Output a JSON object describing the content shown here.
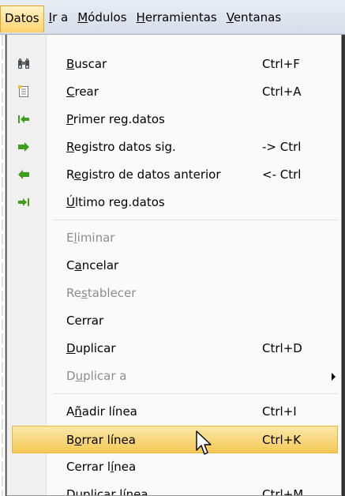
{
  "menubar": {
    "items": [
      {
        "label": "Datos",
        "mnemonic_index": -1
      },
      {
        "label": "Ir a",
        "mnemonic_index": 0
      },
      {
        "label": "Módulos",
        "mnemonic_index": 0
      },
      {
        "label": "Herramientas",
        "mnemonic_index": 0
      },
      {
        "label": "Ventanas",
        "mnemonic_index": 0
      }
    ]
  },
  "menu": {
    "items": [
      {
        "label": "Buscar",
        "shortcut": "Ctrl+F",
        "icon": "binoculars-icon",
        "disabled": false
      },
      {
        "label": "Crear",
        "shortcut": "Ctrl+A",
        "icon": "new-document-icon",
        "disabled": false
      },
      {
        "label": "Primer reg.datos",
        "shortcut": "",
        "icon": "first-record-icon",
        "disabled": false
      },
      {
        "label": "Registro datos sig.",
        "shortcut": "-> Ctrl",
        "icon": "next-record-icon",
        "disabled": false
      },
      {
        "label": "Registro de datos anterior",
        "shortcut": "<- Ctrl",
        "icon": "previous-record-icon",
        "disabled": false
      },
      {
        "label": "Último reg.datos",
        "shortcut": "",
        "icon": "last-record-icon",
        "disabled": false
      },
      {
        "label": "Eliminar",
        "shortcut": "",
        "disabled": true
      },
      {
        "label": "Cancelar",
        "shortcut": "",
        "disabled": false
      },
      {
        "label": "Restablecer",
        "shortcut": "",
        "disabled": true
      },
      {
        "label": "Cerrar",
        "shortcut": "",
        "disabled": false
      },
      {
        "label": "Duplicar",
        "shortcut": "Ctrl+D",
        "disabled": false
      },
      {
        "label": "Duplicar a",
        "shortcut": "",
        "disabled": true,
        "submenu": true
      },
      {
        "label": "Añadir línea",
        "shortcut": "Ctrl+I",
        "disabled": false
      },
      {
        "label": "Borrar línea",
        "shortcut": "Ctrl+K",
        "disabled": false,
        "highlighted": true
      },
      {
        "label": "Cerrar línea",
        "shortcut": "",
        "disabled": false
      },
      {
        "label": "Duplicar línea",
        "shortcut": "Ctrl+M",
        "disabled": false
      }
    ]
  },
  "colors": {
    "highlight": "#f6c956",
    "disabled_text": "#8d8d8d",
    "arrow_green": "#3f9e1d"
  }
}
